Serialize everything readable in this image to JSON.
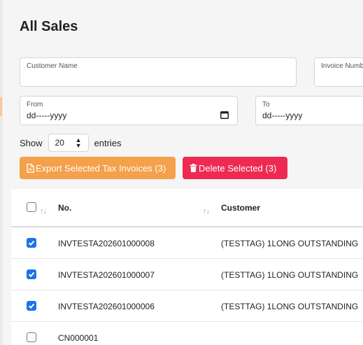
{
  "page": {
    "title": "All Sales"
  },
  "filters": {
    "customer_name": {
      "label": "Customer Name",
      "value": ""
    },
    "invoice_number": {
      "label": "Invoice Numb",
      "value": ""
    },
    "from": {
      "label": "From",
      "value": "dd-----yyyy"
    },
    "to": {
      "label": "To",
      "value": "dd-----yyyy"
    }
  },
  "length_menu": {
    "show_label": "Show",
    "selected": "20",
    "entries_label": "entries"
  },
  "actions": {
    "export_label": "Export Selected Tax Invoices (3)",
    "delete_label": "Delete Selected (3)"
  },
  "table": {
    "columns": [
      "No.",
      "Customer"
    ],
    "rows": [
      {
        "checked": true,
        "no": "INVTESTA202601000008",
        "customer": "(TESTTAG) 1LONG OUTSTANDING"
      },
      {
        "checked": true,
        "no": "INVTESTA202601000007",
        "customer": "(TESTTAG) 1LONG OUTSTANDING"
      },
      {
        "checked": true,
        "no": "INVTESTA202601000006",
        "customer": "(TESTTAG) 1LONG OUTSTANDING"
      },
      {
        "checked": false,
        "no": "CN000001",
        "customer": ""
      }
    ]
  },
  "colors": {
    "export": "#f5a04a",
    "delete": "#ee2a52",
    "checkbox": "#1a73e8"
  },
  "icons": {
    "export": "pdf-file-icon",
    "delete": "trash-icon",
    "date": "calendar-icon",
    "sort": "sort-icon"
  }
}
